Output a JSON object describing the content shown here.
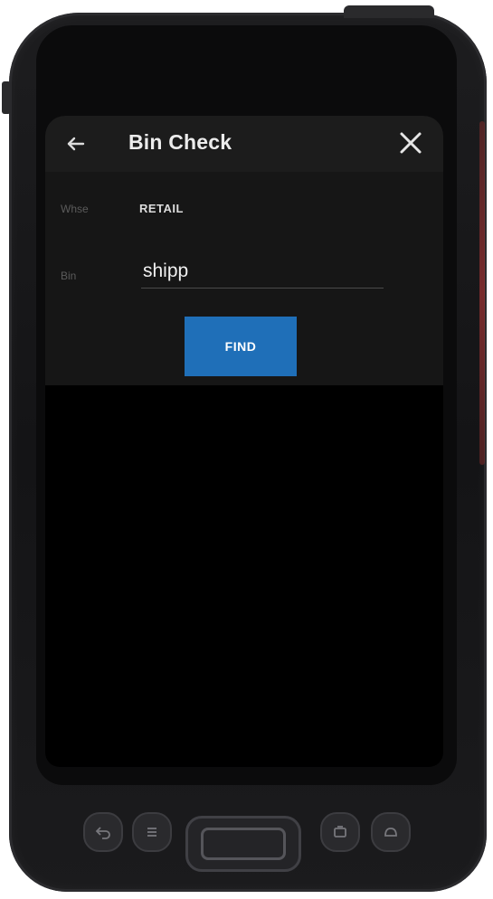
{
  "app": {
    "title": "Bin Check"
  },
  "icons": {
    "back": "back-arrow-icon",
    "close": "close-icon"
  },
  "form": {
    "whse_label": "Whse",
    "whse_value": "RETAIL",
    "bin_label": "Bin",
    "bin_value": "shipp",
    "find_label": "FIND"
  },
  "colors": {
    "accent": "#1f6fb8",
    "appbar": "#1c1c1c",
    "background": "#000000"
  }
}
